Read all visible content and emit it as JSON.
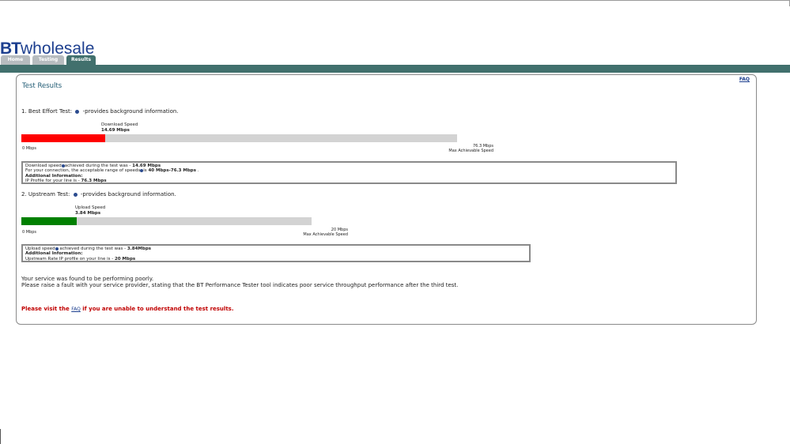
{
  "header": {
    "logo_bt": "BT",
    "logo_wholesale": "wholesale",
    "tabs": [
      {
        "label": "Home",
        "active": false
      },
      {
        "label": "Testing",
        "active": false
      },
      {
        "label": "Results",
        "active": true
      }
    ]
  },
  "panel": {
    "title": "Test Results",
    "faq_link": "FAQ"
  },
  "download": {
    "heading_prefix": "1. Best Effort Test:",
    "heading_suffix": "-provides background information.",
    "speed_label": "Download Speed",
    "speed_value": "14.69 Mbps",
    "measured_mbps": 14.69,
    "max_mbps": 76.3,
    "fill_color": "#ff0000",
    "scale_min": "0 Mbps",
    "scale_max": "76.3 Mbps",
    "scale_max_label": "Max Achievable Speed",
    "info": {
      "line1_a": "Download speed",
      "line1_b": "achieved during the test was -",
      "line1_value": "14.69 Mbps",
      "line2_a": "For your connection, the acceptable range of speeds",
      "line2_b": "is",
      "line2_value": "40 Mbps-76.3 Mbps",
      "line2_end": ".",
      "line3": "Additional Information:",
      "line4_a": "IP Profile for your line is -",
      "line4_value": "76.3 Mbps"
    }
  },
  "upload": {
    "heading_prefix": "2. Upstream Test:",
    "heading_suffix": "-provides background information.",
    "speed_label": "Upload Speed",
    "speed_value": "3.84 Mbps",
    "measured_mbps": 3.84,
    "max_mbps": 20,
    "fill_color": "#008000",
    "scale_min": "0 Mbps",
    "scale_max": "20 Mbps",
    "scale_max_label": "Max Achievable Speed",
    "info": {
      "line1_a": "Upload speed",
      "line1_b": "achieved during the test was -",
      "line1_value": "3.84Mbps",
      "line2": "Additional Information:",
      "line3_a": "Upstream Rate IP profile on your line is -",
      "line3_value": "20 Mbps"
    }
  },
  "summary": {
    "line1": "Your service was found to be performing poorly.",
    "line2": "Please raise a fault with your service provider, stating that the BT Performance Tester tool indicates poor service throughput performance after the third test.",
    "warn_prefix": "Please visit the",
    "warn_link": "FAQ",
    "warn_suffix": "if you are unable to understand the test results."
  }
}
